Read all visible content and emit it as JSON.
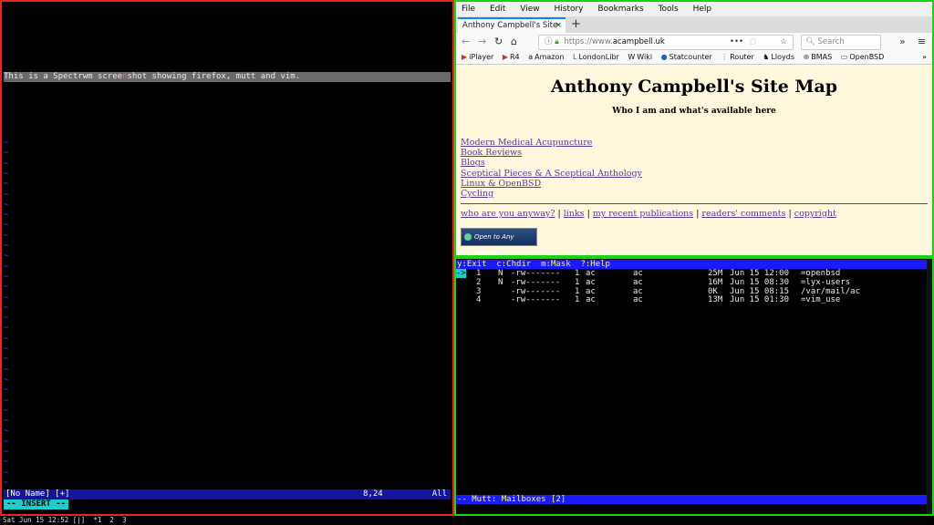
{
  "vim": {
    "line1_pre": "This is a Spectrwm scree",
    "line1_mis": "n",
    "line1_post": "shot showing firefox, mutt and vim.",
    "status_name": "[No Name] [+]",
    "status_pos": "8,24",
    "status_all": "All",
    "mode": "-- INSERT --",
    "tilde": "~"
  },
  "firefox": {
    "menu": [
      "File",
      "Edit",
      "View",
      "History",
      "Bookmarks",
      "Tools",
      "Help"
    ],
    "tab_title": "Anthony Campbell's Site",
    "tab_close": "×",
    "new_tab": "+",
    "url_proto": "https://www.",
    "url_host": "acampbell.uk",
    "search_placeholder": "Search",
    "bookmarks": [
      "iPlayer",
      "R4",
      "Amazon",
      "LondonLibr",
      "Wiki",
      "Statcounter",
      "Router",
      "Lloyds",
      "BMAS",
      "OpenBSD"
    ],
    "page": {
      "title": "Anthony Campbell's Site Map",
      "subtitle": "Who I am and what's available here",
      "links": [
        "Modern Medical Acupuncture",
        "Book Reviews",
        "Blogs",
        "Sceptical Pieces & A Sceptical Anthology",
        "Linux & OpenBSD",
        "Cycling"
      ],
      "foot_links": [
        "who are you anyway?",
        "links",
        "my recent publications",
        "readers' comments",
        "copyright"
      ],
      "badge": "Open to Any Browser..."
    }
  },
  "mutt": {
    "help_bar": "y:Exit  c:Chdir  m:Mask  ?:Help",
    "rows": [
      {
        "num": "1",
        "flag": "N",
        "perm": "-rw-------",
        "links": "1",
        "user": "ac",
        "group": "ac",
        "size": "25M",
        "date": "Jun 15 12:00",
        "name": "=openbsd"
      },
      {
        "num": "2",
        "flag": "N",
        "perm": "-rw-------",
        "links": "1",
        "user": "ac",
        "group": "ac",
        "size": "16M",
        "date": "Jun 15 08:30",
        "name": "=lyx-users"
      },
      {
        "num": "3",
        "flag": "",
        "perm": "-rw-------",
        "links": "1",
        "user": "ac",
        "group": "ac",
        "size": "0K",
        "date": "Jun 15 08:15",
        "name": "/var/mail/ac"
      },
      {
        "num": "4",
        "flag": "",
        "perm": "-rw-------",
        "links": "1",
        "user": "ac",
        "group": "ac",
        "size": "13M",
        "date": "Jun 15 01:30",
        "name": "=vim_use"
      }
    ],
    "cursor": "->",
    "status_bar": "-- Mutt: Mailboxes [2]"
  },
  "bar": {
    "text": "Sat Jun 15 12:52 [|]  *1  2  3"
  }
}
